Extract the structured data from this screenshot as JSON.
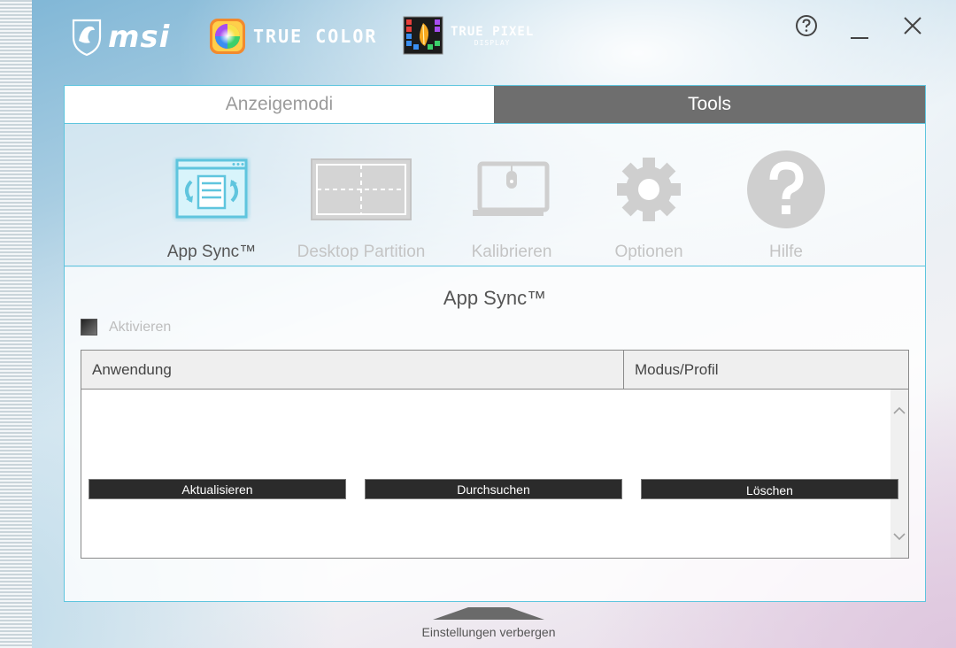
{
  "header": {
    "brand": "msi",
    "true_color": "TRUE COLOR",
    "true_pixel": {
      "main": "TRUE PIXEL",
      "sub": "DISPLAY"
    },
    "window_controls": {
      "help_icon": "help-icon",
      "minimize_icon": "minimize-icon",
      "close_icon": "close-icon"
    }
  },
  "tabs": [
    {
      "label": "Anzeigemodi",
      "active": false
    },
    {
      "label": "Tools",
      "active": true
    }
  ],
  "tools": [
    {
      "label": "App Sync™",
      "icon": "app-sync-icon",
      "active": true
    },
    {
      "label": "Desktop Partition",
      "icon": "desktop-partition-icon",
      "active": false
    },
    {
      "label": "Kalibrieren",
      "icon": "calibrate-icon",
      "active": false
    },
    {
      "label": "Optionen",
      "icon": "gear-icon",
      "active": false
    },
    {
      "label": "Hilfe",
      "icon": "question-icon",
      "active": false
    }
  ],
  "content": {
    "title": "App Sync™",
    "activate_label": "Aktivieren",
    "activate_checked": false,
    "table": {
      "columns": [
        "Anwendung",
        "Modus/Profil"
      ],
      "rows": []
    }
  },
  "buttons": {
    "refresh": "Aktualisieren",
    "browse": "Durchsuchen",
    "delete": "Löschen"
  },
  "footer": {
    "hide_settings": "Einstellungen verbergen"
  },
  "colors": {
    "accent": "#5ec5de",
    "tab_active_bg": "#6e6e6e",
    "button_bg": "#2b2b2b"
  }
}
